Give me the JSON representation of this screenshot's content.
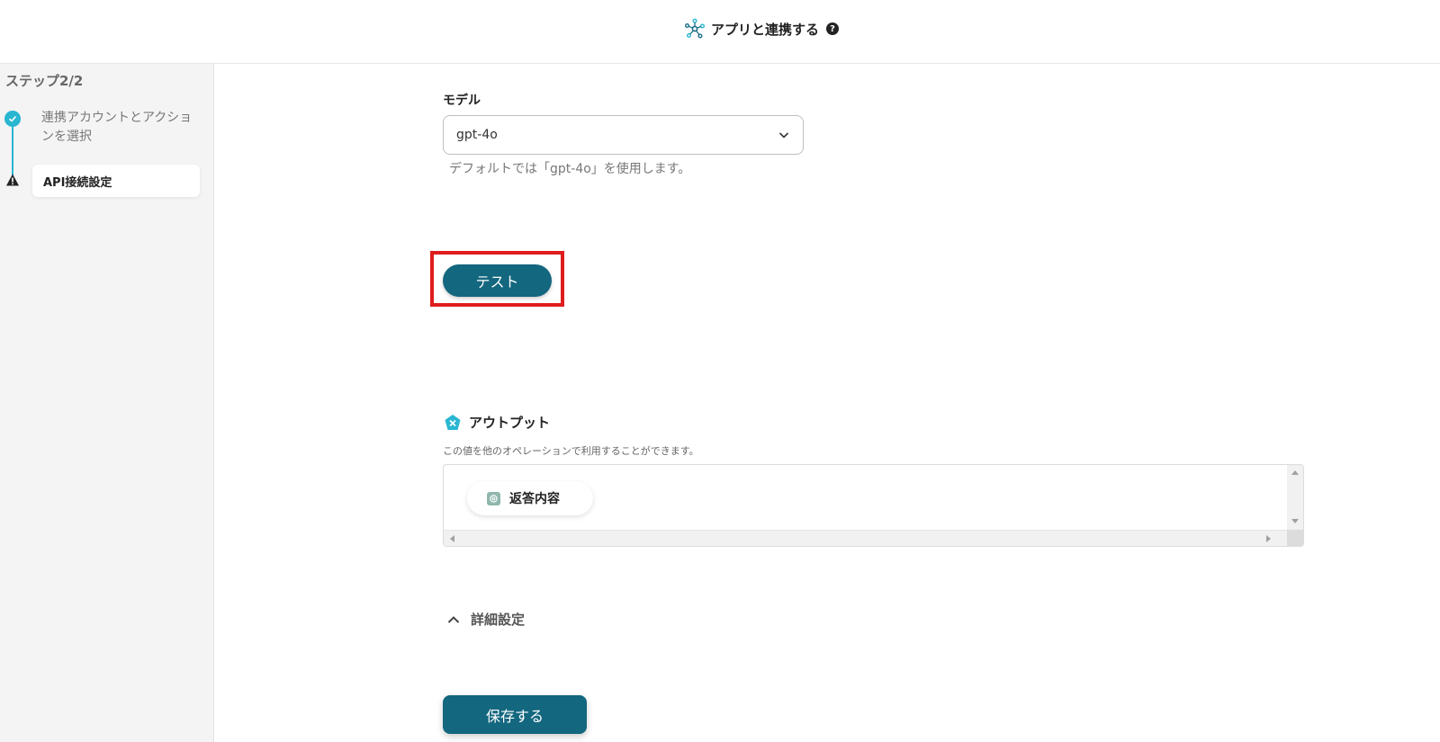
{
  "header": {
    "title": "アプリと連携する",
    "app_icon": "network-hub-icon",
    "help_icon": "question-circle-icon",
    "help_glyph": "?"
  },
  "sidebar": {
    "step_counter": "ステップ2/2",
    "steps": [
      {
        "label": "連携アカウントとアクションを選択",
        "status": "completed",
        "icon": "check-circle-icon"
      },
      {
        "label": "API接続設定",
        "status": "current",
        "icon": "warning-triangle-icon"
      }
    ]
  },
  "main": {
    "model_field": {
      "label": "モデル",
      "value": "gpt-4o",
      "help_text": "デフォルトでは「gpt-4o」を使用します。"
    },
    "test_button": {
      "label": "テスト",
      "highlighted": true
    },
    "output": {
      "title": "アウトプット",
      "description": "この値を他のオペレーションで利用することができます。",
      "items": [
        {
          "label": "返答内容",
          "icon": "openai-icon"
        }
      ]
    },
    "details_toggle": {
      "label": "詳細設定",
      "expanded": true
    },
    "save_button": {
      "label": "保存する"
    }
  },
  "colors": {
    "primary": "#13677f",
    "accent": "#29b6d1",
    "highlight_border": "#e01d1d"
  }
}
